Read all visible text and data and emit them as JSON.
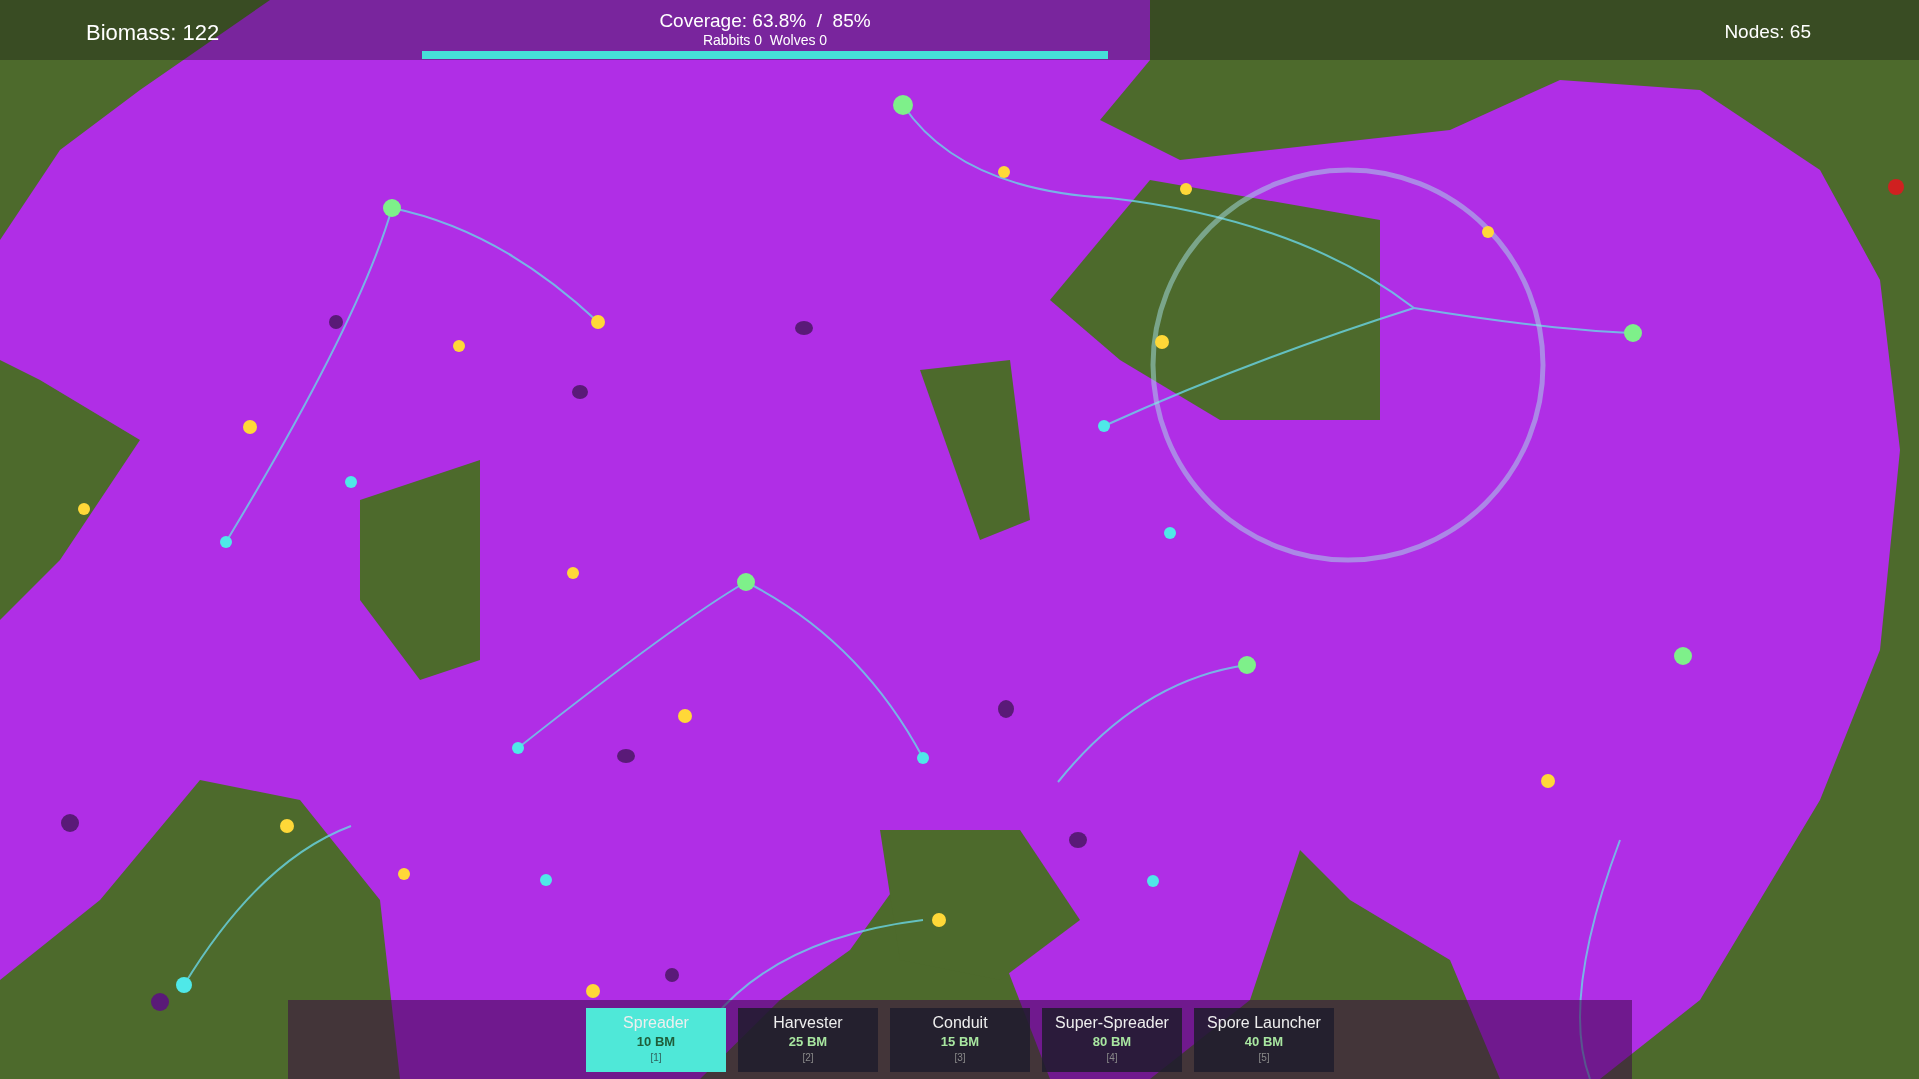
{
  "hud": {
    "biomass": "Biomass: 122",
    "coverage": "Coverage: 63.8%  /  85%",
    "animals": "Rabbits 0  Wolves 0",
    "nodes": "Nodes: 65",
    "coverage_bar": {
      "level": 1.0
    }
  },
  "toolbar": [
    {
      "name": "Spreader",
      "cost": "10 BM",
      "key": "[1]",
      "selected": true
    },
    {
      "name": "Harvester",
      "cost": "25 BM",
      "key": "[2]",
      "selected": false
    },
    {
      "name": "Conduit",
      "cost": "15 BM",
      "key": "[3]",
      "selected": false
    },
    {
      "name": "Super-Spreader",
      "cost": "80 BM",
      "key": "[4]",
      "selected": false
    },
    {
      "name": "Spore Launcher",
      "cost": "40 BM",
      "key": "[5]",
      "selected": false
    }
  ]
}
